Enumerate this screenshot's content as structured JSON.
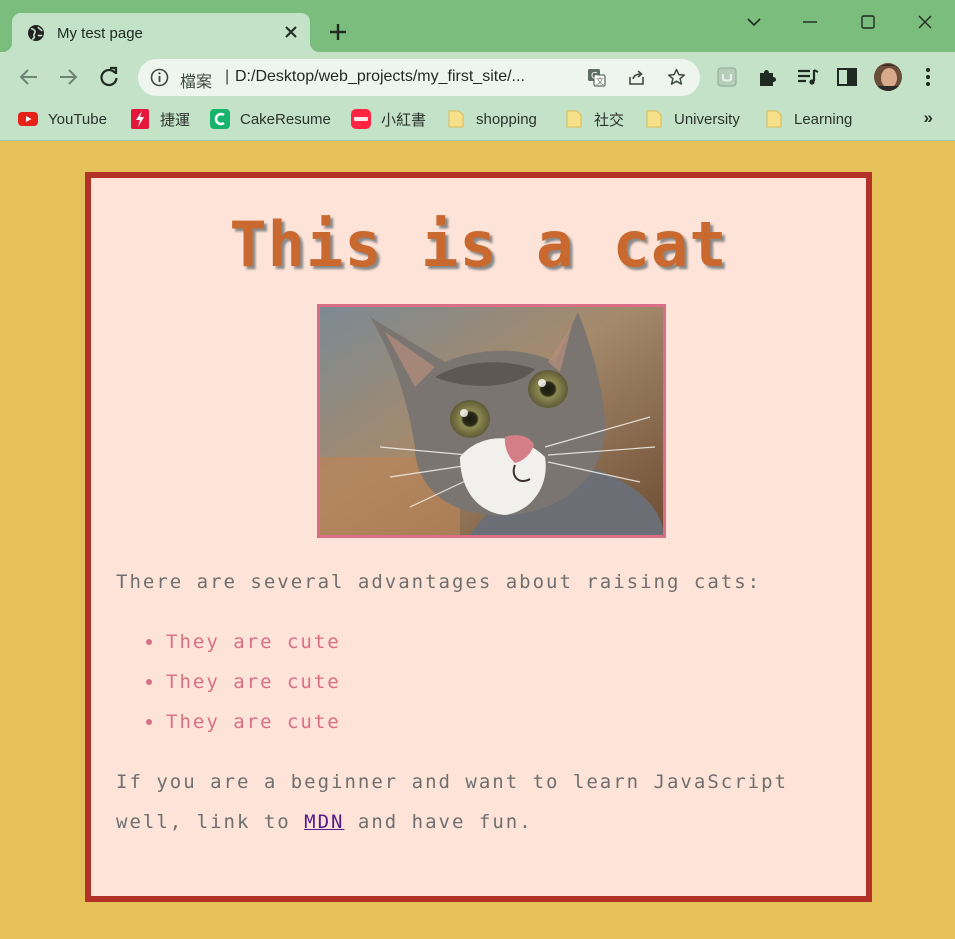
{
  "browser": {
    "tab": {
      "title": "My test page",
      "favicon": "globe-icon"
    },
    "window_controls": [
      "chevron-down-icon",
      "minimize-icon",
      "maximize-icon",
      "close-icon"
    ],
    "omnibox": {
      "scheme_label": "檔案",
      "separator": "|",
      "url": "D:/Desktop/web_projects/my_first_site/...",
      "icons": [
        "translate-icon",
        "share-icon",
        "star-icon"
      ]
    },
    "toolbar_icons": [
      "back-icon",
      "forward-icon",
      "reload-icon",
      "pocket-icon",
      "extensions-icon",
      "media-icon",
      "side-panel-icon",
      "profile-avatar"
    ],
    "bookmarks": [
      {
        "label": "YouTube",
        "icon": "youtube-icon"
      },
      {
        "label": "捷運",
        "icon": "app-icon"
      },
      {
        "label": "CakeResume",
        "icon": "cakeresume-icon"
      },
      {
        "label": "小紅書",
        "icon": "xiaohongshu-icon"
      },
      {
        "label": "shopping",
        "icon": "folder-icon"
      },
      {
        "label": "社交",
        "icon": "folder-icon"
      },
      {
        "label": "University",
        "icon": "folder-icon"
      },
      {
        "label": "Learning",
        "icon": "folder-icon"
      }
    ],
    "bookmarks_overflow": "»"
  },
  "page": {
    "title": "This is a cat",
    "image": "cat photo",
    "intro": "There are several advantages about raising cats:",
    "list": [
      "They are cute",
      "They are cute",
      "They are cute"
    ],
    "outro_before": "If you are a beginner and want to learn JavaScript well, link to ",
    "link_text": "MDN",
    "outro_after": " and have fun."
  },
  "colors": {
    "page_background": "#e6c15a",
    "card_background": "#fde3d8",
    "card_border": "#b33227",
    "title": "#c9692f",
    "list_text": "#d96f86",
    "body_text": "#6f6f6f",
    "tabstrip": "#7bbd7c",
    "toolbar": "#c3e2c7"
  }
}
